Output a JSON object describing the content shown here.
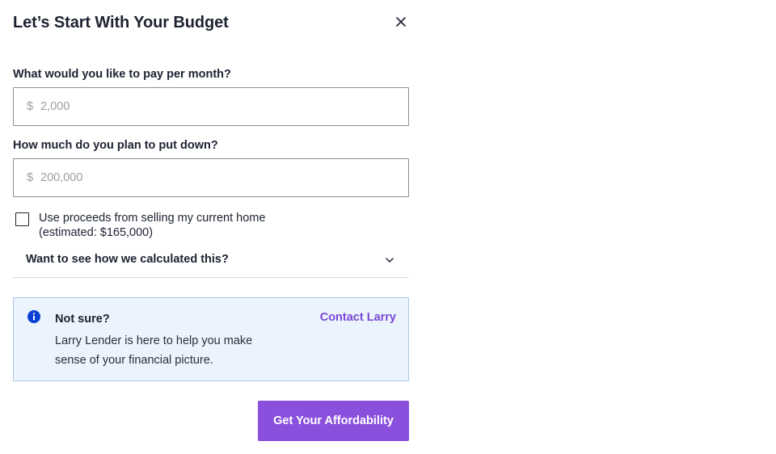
{
  "modal": {
    "title": "Let’s Start With Your Budget",
    "close_icon": "close-icon"
  },
  "monthly_payment": {
    "label": "What would you like to pay per month?",
    "prefix": "$",
    "value": "",
    "placeholder": "2,000"
  },
  "down_payment": {
    "label": "How much do you plan to put down?",
    "prefix": "$",
    "value": "",
    "placeholder": "200,000"
  },
  "use_proceeds": {
    "checked": false,
    "label_line1": "Use proceeds from selling my current home",
    "label_line2": "(estimated: $165,000)"
  },
  "calculation_accordion": {
    "label": "Want to see how we calculated this?",
    "icon": "chevron-down-icon"
  },
  "help_box": {
    "icon": "info-icon",
    "title": "Not sure?",
    "body_line1": "Larry Lender is here to help you make",
    "body_line2": "sense of your financial picture.",
    "link_label": "Contact Larry"
  },
  "submit_button": {
    "label": "Get Your Affordability"
  },
  "colors": {
    "accent": "#8a4fdc",
    "link": "#7a47d6",
    "info_bg": "#ebf3fc",
    "info_border": "#a9c9ea",
    "info_icon": "#0b3fd1",
    "text": "#1c2230"
  }
}
